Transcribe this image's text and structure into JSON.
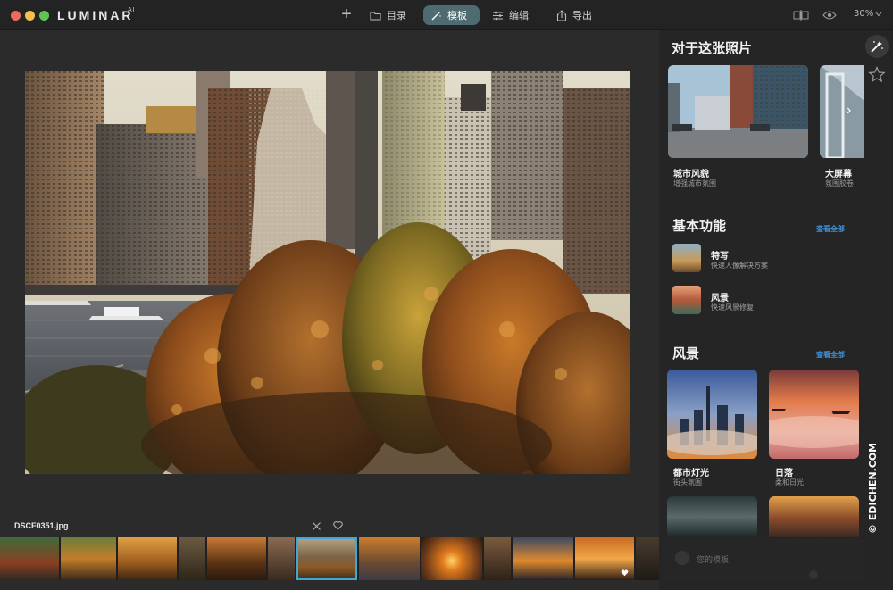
{
  "toolbar": {
    "brand": "LUMINAR",
    "brand_suffix": "AI",
    "tabs": [
      {
        "label": "目录",
        "icon": "folder-icon"
      },
      {
        "label": "模板",
        "icon": "magic-wand-icon",
        "active": true
      },
      {
        "label": "编辑",
        "icon": "sliders-icon"
      },
      {
        "label": "导出",
        "icon": "share-icon"
      }
    ],
    "zoom": "30%"
  },
  "photo": {
    "filename": "DSCF0351.jpg"
  },
  "panel": {
    "for_this_photo": {
      "title": "对于这张照片",
      "cards": [
        {
          "label": "城市风貌",
          "sub": "增强城市氛围"
        },
        {
          "label": "大屏幕",
          "sub": "氛围胶卷"
        }
      ]
    },
    "essentials": {
      "title": "基本功能",
      "see_all": "查看全部",
      "items": [
        {
          "title": "特写",
          "sub": "快速人像解决方案"
        },
        {
          "title": "风景",
          "sub": "快速风景修复"
        }
      ]
    },
    "landscape": {
      "title": "风景",
      "see_all": "查看全部",
      "cards": [
        {
          "label": "都市灯光",
          "sub": "街头氛围"
        },
        {
          "label": "日落",
          "sub": "柔和日光"
        }
      ]
    },
    "my_templates": "您的模板"
  },
  "watermark": "© EDICHEN.COM",
  "colors": {
    "accent": "#4e6b72",
    "link": "#3f8fd8",
    "selection": "#3fa8d6"
  }
}
